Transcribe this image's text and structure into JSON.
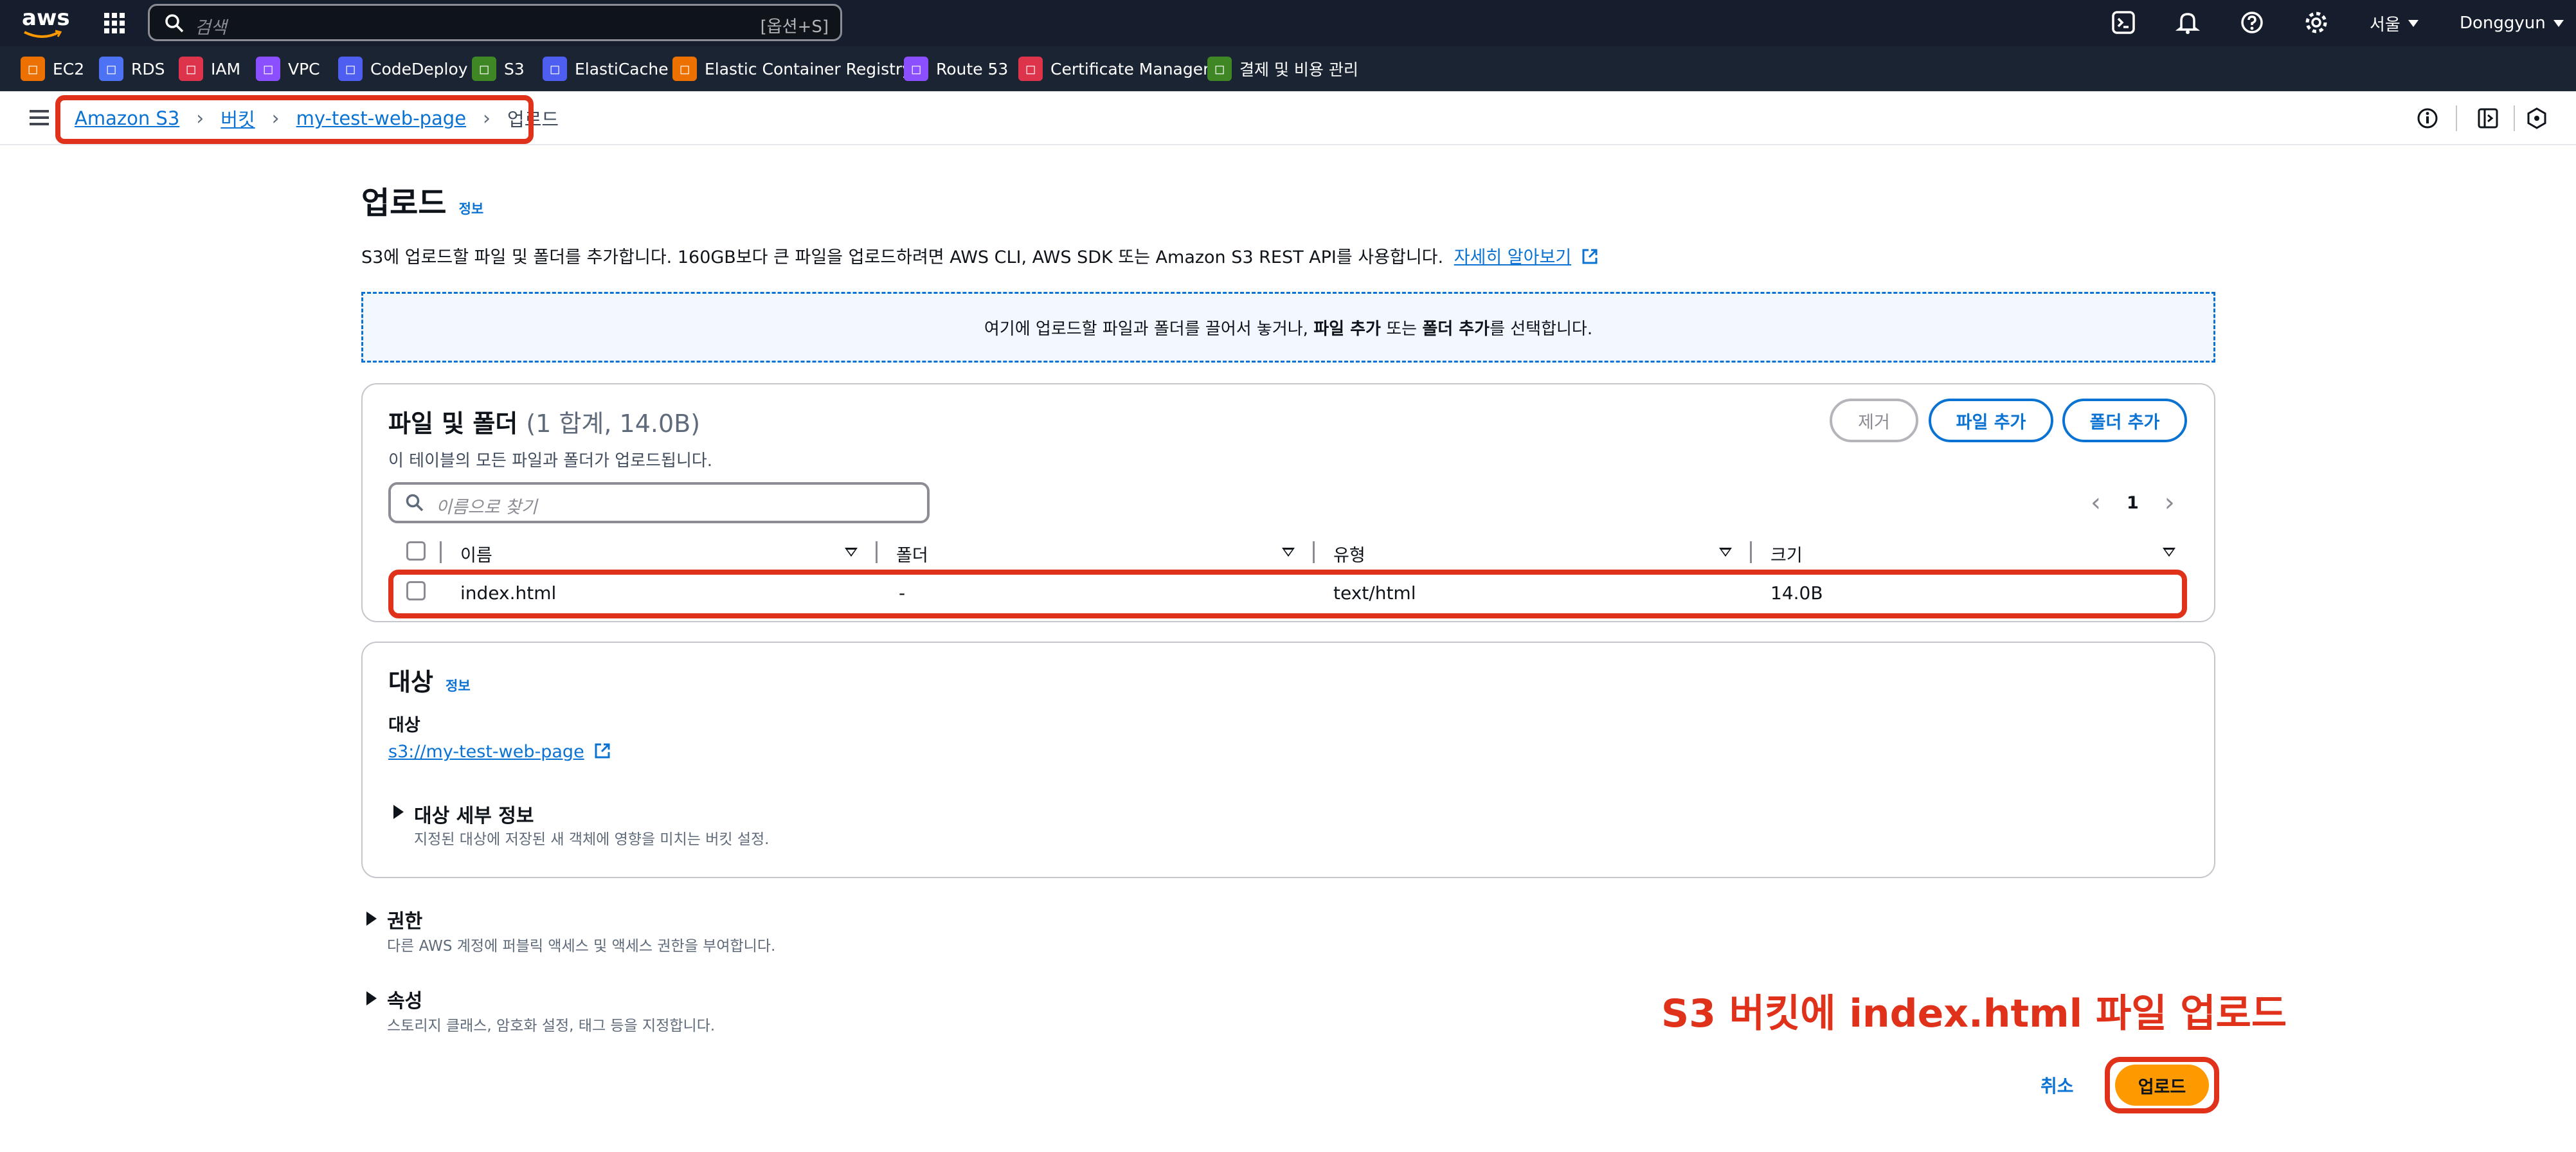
{
  "topnav": {
    "logo": "aws",
    "search_placeholder": "검색",
    "search_shortcut": "[옵션+S]",
    "region": "서울",
    "user": "Donggyun"
  },
  "services": [
    {
      "label": "EC2",
      "color": "#ed7100",
      "icon": "ec2-icon"
    },
    {
      "label": "RDS",
      "color": "#4d72f3",
      "icon": "rds-icon"
    },
    {
      "label": "IAM",
      "color": "#dd344c",
      "icon": "iam-icon"
    },
    {
      "label": "VPC",
      "color": "#8c4fff",
      "icon": "vpc-icon"
    },
    {
      "label": "CodeDeploy",
      "color": "#4d5ef0",
      "icon": "codedeploy-icon"
    },
    {
      "label": "S3",
      "color": "#3f8624",
      "icon": "s3-icon"
    },
    {
      "label": "ElastiCache",
      "color": "#4d5ef0",
      "icon": "elasticache-icon"
    },
    {
      "label": "Elastic Container Registry",
      "color": "#ed7100",
      "icon": "ecr-icon"
    },
    {
      "label": "Route 53",
      "color": "#8c4fff",
      "icon": "route53-icon"
    },
    {
      "label": "Certificate Manager",
      "color": "#dd344c",
      "icon": "certificate-manager-icon"
    },
    {
      "label": "결제 및 비용 관리",
      "color": "#3f8624",
      "icon": "billing-icon"
    }
  ],
  "breadcrumb": {
    "items": [
      "Amazon S3",
      "버킷",
      "my-test-web-page"
    ],
    "current": "업로드"
  },
  "page": {
    "title": "업로드",
    "info": "정보",
    "description": "S3에 업로드할 파일 및 폴더를 추가합니다. 160GB보다 큰 파일을 업로드하려면 AWS CLI, AWS SDK 또는 Amazon S3 REST API를 사용합니다.",
    "learn_more": "자세히 알아보기"
  },
  "dropzone": {
    "text_1": "여기에 업로드할 파일과 폴더를 끌어서 놓거나, ",
    "bold_1": "파일 추가",
    "text_2": " 또는 ",
    "bold_2": "폴더 추가",
    "text_3": "를 선택합니다."
  },
  "files": {
    "title": "파일 및 폴더",
    "summary": "(1 합계, 14.0B)",
    "subtitle": "이 테이블의 모든 파일과 폴더가 업로드됩니다.",
    "remove_label": "제거",
    "add_files_label": "파일 추가",
    "add_folder_label": "폴더 추가",
    "filter_placeholder": "이름으로 찾기",
    "page_number": "1",
    "columns": [
      "이름",
      "폴더",
      "유형",
      "크기"
    ],
    "rows": [
      {
        "name": "index.html",
        "folder": "-",
        "type": "text/html",
        "size": "14.0B"
      }
    ]
  },
  "destination": {
    "title": "대상",
    "info": "정보",
    "label": "대상",
    "value": "s3://my-test-web-page",
    "details_title": "대상 세부 정보",
    "details_desc": "지정된 대상에 저장된 새 객체에 영향을 미치는 버킷 설정."
  },
  "permissions": {
    "title": "권한",
    "desc": "다른 AWS 계정에 퍼블릭 액세스 및 액세스 권한을 부여합니다."
  },
  "properties": {
    "title": "속성",
    "desc": "스토리지 클래스, 암호화 설정, 태그 등을 지정합니다."
  },
  "annotation": "S3 버킷에 index.html 파일 업로드",
  "actions": {
    "cancel": "취소",
    "upload": "업로드"
  },
  "colors": {
    "nav_bg": "#161e2d",
    "link": "#0972d3",
    "primary": "#ff9900",
    "annotation": "#e0321b"
  }
}
